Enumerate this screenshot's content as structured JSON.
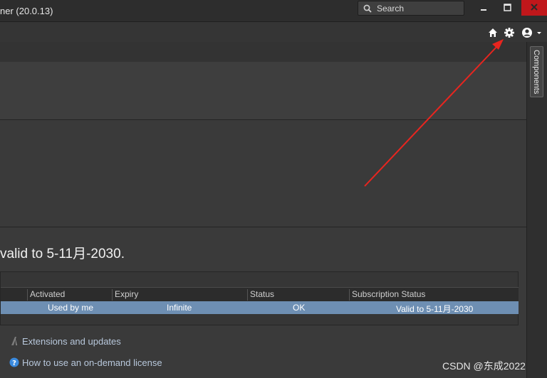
{
  "window": {
    "title": "ner (20.0.13)",
    "search_placeholder": "Search"
  },
  "toolbar": {
    "icons": [
      "home-icon",
      "gear-icon",
      "user-account-icon",
      "chevron-down-icon"
    ]
  },
  "license": {
    "heading": "valid to 5-11月-2030.",
    "table": {
      "columns": [
        "Activated",
        "Expiry",
        "Status",
        "Subscription Status"
      ],
      "rows": [
        {
          "activated": "Used by me",
          "expiry": "Infinite",
          "status": "OK",
          "subscription_status": "Valid to 5-11月-2030"
        }
      ]
    }
  },
  "links": {
    "extensions": "Extensions and updates",
    "on_demand": "How to use an on-demand license"
  },
  "side_panel": {
    "components_tab": "Components"
  },
  "watermark": "CSDN @东成2022",
  "colors": {
    "accent_selection": "#6e8fb3",
    "close_button": "#c0171b",
    "annotation_arrow": "#e8251f"
  }
}
